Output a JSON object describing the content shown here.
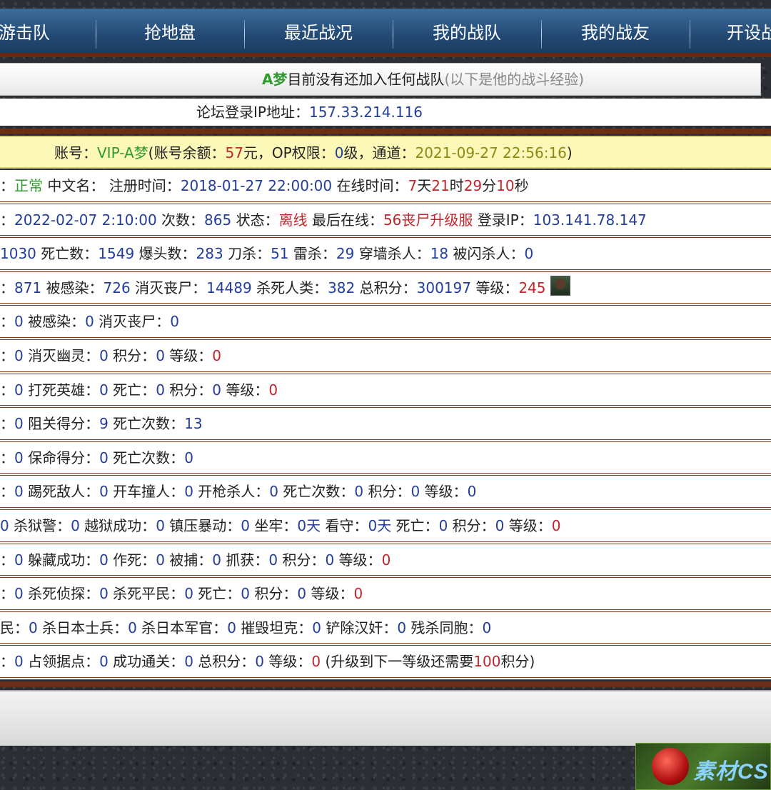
{
  "nav": [
    "游击队",
    "抢地盘",
    "最近战况",
    "我的战队",
    "我的战友",
    "开设战"
  ],
  "notice": {
    "name": "A梦",
    "text": "目前没有还加入任何战队",
    "hint": "(以下是他的战斗经验)"
  },
  "ip": {
    "label": "论坛登录IP地址：",
    "value": "157.33.214.116"
  },
  "account": {
    "label": "账号：",
    "name": "VIP-A梦",
    "balance_label": "(账号余额：",
    "balance": "57",
    "op_label": "元，OP权限：",
    "op": "0",
    "channel_label": "级，通道：",
    "channel": "2021-09-27 22:56:16",
    "close": ")"
  },
  "rows": [
    [
      [
        "t",
        "："
      ],
      [
        "g",
        "正常"
      ],
      [
        "t",
        " 中文名： 注册时间："
      ],
      [
        "b",
        "2018-01-27 22:00:00"
      ],
      [
        "t",
        " 在线时间："
      ],
      [
        "r",
        "7"
      ],
      [
        "t",
        "天"
      ],
      [
        "r",
        "21"
      ],
      [
        "t",
        "时"
      ],
      [
        "r",
        "29"
      ],
      [
        "t",
        "分"
      ],
      [
        "r",
        "10"
      ],
      [
        "t",
        "秒"
      ]
    ],
    [
      [
        "t",
        "："
      ],
      [
        "b",
        "2022-02-07 2:10:00"
      ],
      [
        "t",
        " 次数："
      ],
      [
        "b",
        "865"
      ],
      [
        "t",
        " 状态："
      ],
      [
        "r",
        "离线"
      ],
      [
        "t",
        " 最后在线："
      ],
      [
        "r",
        "56丧尸升级服"
      ],
      [
        "t",
        " 登录IP："
      ],
      [
        "b",
        "103.141.78.147"
      ]
    ],
    [
      [
        "b",
        "1030"
      ],
      [
        "t",
        " 死亡数："
      ],
      [
        "b",
        "1549"
      ],
      [
        "t",
        " 爆头数："
      ],
      [
        "b",
        "283"
      ],
      [
        "t",
        " 刀杀："
      ],
      [
        "b",
        "51"
      ],
      [
        "t",
        " 雷杀："
      ],
      [
        "b",
        "29"
      ],
      [
        "t",
        " 穿墙杀人："
      ],
      [
        "b",
        "18"
      ],
      [
        "t",
        " 被闪杀人："
      ],
      [
        "b",
        "0"
      ]
    ],
    [
      [
        "t",
        "："
      ],
      [
        "b",
        "871"
      ],
      [
        "t",
        " 被感染："
      ],
      [
        "b",
        "726"
      ],
      [
        "t",
        " 消灭丧尸："
      ],
      [
        "b",
        "14489"
      ],
      [
        "t",
        " 杀死人类："
      ],
      [
        "b",
        "382"
      ],
      [
        "t",
        " 总积分："
      ],
      [
        "b",
        "300197"
      ],
      [
        "t",
        " 等级："
      ],
      [
        "r",
        "245"
      ],
      [
        "i",
        "avatar"
      ]
    ],
    [
      [
        "t",
        "："
      ],
      [
        "b",
        "0"
      ],
      [
        "t",
        " 被感染："
      ],
      [
        "b",
        "0"
      ],
      [
        "t",
        " 消灭丧尸："
      ],
      [
        "b",
        "0"
      ]
    ],
    [
      [
        "t",
        "："
      ],
      [
        "b",
        "0"
      ],
      [
        "t",
        " 消灭幽灵："
      ],
      [
        "b",
        "0"
      ],
      [
        "t",
        " 积分："
      ],
      [
        "b",
        "0"
      ],
      [
        "t",
        " 等级："
      ],
      [
        "r",
        "0"
      ]
    ],
    [
      [
        "t",
        "："
      ],
      [
        "b",
        "0"
      ],
      [
        "t",
        " 打死英雄："
      ],
      [
        "b",
        "0"
      ],
      [
        "t",
        " 死亡："
      ],
      [
        "b",
        "0"
      ],
      [
        "t",
        " 积分："
      ],
      [
        "b",
        "0"
      ],
      [
        "t",
        " 等级："
      ],
      [
        "r",
        "0"
      ]
    ],
    [
      [
        "t",
        "："
      ],
      [
        "b",
        "0"
      ],
      [
        "t",
        " 阻关得分："
      ],
      [
        "b",
        "9"
      ],
      [
        "t",
        " 死亡次数："
      ],
      [
        "b",
        "13"
      ]
    ],
    [
      [
        "t",
        "："
      ],
      [
        "b",
        "0"
      ],
      [
        "t",
        " 保命得分："
      ],
      [
        "b",
        "0"
      ],
      [
        "t",
        " 死亡次数："
      ],
      [
        "b",
        "0"
      ]
    ],
    [
      [
        "t",
        "："
      ],
      [
        "b",
        "0"
      ],
      [
        "t",
        " 踢死敌人："
      ],
      [
        "b",
        "0"
      ],
      [
        "t",
        " 开车撞人："
      ],
      [
        "b",
        "0"
      ],
      [
        "t",
        " 开枪杀人："
      ],
      [
        "b",
        "0"
      ],
      [
        "t",
        " 死亡次数："
      ],
      [
        "b",
        "0"
      ],
      [
        "t",
        " 积分："
      ],
      [
        "b",
        "0"
      ],
      [
        "t",
        " 等级："
      ],
      [
        "b",
        "0"
      ]
    ],
    [
      [
        "b",
        "0"
      ],
      [
        "t",
        " 杀狱警："
      ],
      [
        "b",
        "0"
      ],
      [
        "t",
        " 越狱成功："
      ],
      [
        "b",
        "0"
      ],
      [
        "t",
        " 镇压暴动："
      ],
      [
        "b",
        "0"
      ],
      [
        "t",
        " 坐牢："
      ],
      [
        "b",
        "0天"
      ],
      [
        "t",
        " 看守："
      ],
      [
        "b",
        "0天"
      ],
      [
        "t",
        " 死亡："
      ],
      [
        "b",
        "0"
      ],
      [
        "t",
        " 积分："
      ],
      [
        "b",
        "0"
      ],
      [
        "t",
        " 等级："
      ],
      [
        "r",
        "0"
      ]
    ],
    [
      [
        "t",
        "："
      ],
      [
        "b",
        "0"
      ],
      [
        "t",
        " 躲藏成功："
      ],
      [
        "b",
        "0"
      ],
      [
        "t",
        " 作死："
      ],
      [
        "b",
        "0"
      ],
      [
        "t",
        " 被捕："
      ],
      [
        "b",
        "0"
      ],
      [
        "t",
        " 抓获："
      ],
      [
        "b",
        "0"
      ],
      [
        "t",
        " 积分："
      ],
      [
        "b",
        "0"
      ],
      [
        "t",
        " 等级："
      ],
      [
        "r",
        "0"
      ]
    ],
    [
      [
        "t",
        "："
      ],
      [
        "b",
        "0"
      ],
      [
        "t",
        " 杀死侦探："
      ],
      [
        "b",
        "0"
      ],
      [
        "t",
        " 杀死平民："
      ],
      [
        "b",
        "0"
      ],
      [
        "t",
        " 死亡："
      ],
      [
        "b",
        "0"
      ],
      [
        "t",
        " 积分："
      ],
      [
        "b",
        "0"
      ],
      [
        "t",
        " 等级："
      ],
      [
        "r",
        "0"
      ]
    ],
    [
      [
        "t",
        "民："
      ],
      [
        "b",
        "0"
      ],
      [
        "t",
        " 杀日本士兵："
      ],
      [
        "b",
        "0"
      ],
      [
        "t",
        " 杀日本军官："
      ],
      [
        "b",
        "0"
      ],
      [
        "t",
        " 摧毁坦克："
      ],
      [
        "b",
        "0"
      ],
      [
        "t",
        " 铲除汉奸："
      ],
      [
        "b",
        "0"
      ],
      [
        "t",
        " 残杀同胞："
      ],
      [
        "b",
        "0"
      ]
    ],
    [
      [
        "t",
        "："
      ],
      [
        "b",
        "0"
      ],
      [
        "t",
        " 占领据点："
      ],
      [
        "b",
        "0"
      ],
      [
        "t",
        " 成功通关："
      ],
      [
        "b",
        "0"
      ],
      [
        "t",
        " 总积分："
      ],
      [
        "b",
        "0"
      ],
      [
        "t",
        " 等级："
      ],
      [
        "r",
        "0"
      ],
      [
        "t",
        " (升级到下一等级还需要"
      ],
      [
        "r",
        "100"
      ],
      [
        "t",
        "积分)"
      ]
    ]
  ],
  "logo": "素材CS"
}
